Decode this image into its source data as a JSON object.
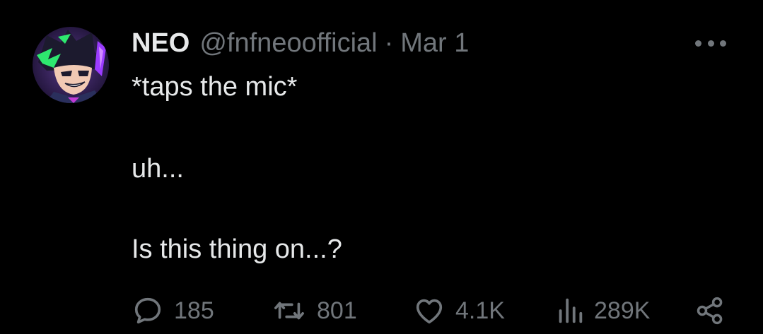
{
  "tweet": {
    "author_name": "NEO",
    "author_handle": "@fnfneoofficial",
    "separator": "·",
    "date": "Mar 1",
    "lines": [
      "*taps the mic*",
      "uh...",
      "Is this thing on...?"
    ]
  },
  "actions": {
    "replies": "185",
    "retweets": "801",
    "likes": "4.1K",
    "views": "289K"
  },
  "icons": {
    "more": "more-horizontal-icon",
    "reply": "reply-bubble-icon",
    "retweet": "retweet-icon",
    "like": "heart-icon",
    "views": "bar-chart-icon",
    "share": "share-icon"
  },
  "colors": {
    "background": "#000000",
    "primary_text": "#e7e9ea",
    "secondary_text": "#71767b",
    "avatar_accent_green": "#2ee86f",
    "avatar_accent_purple": "#9b3cff"
  }
}
